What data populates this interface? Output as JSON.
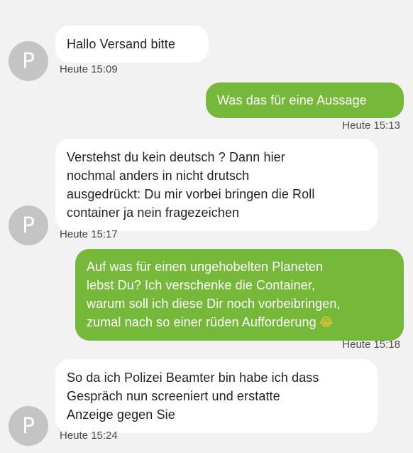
{
  "avatar_letter": "P",
  "messages": [
    {
      "direction": "in",
      "lines": [
        "Hallo Versand bitte"
      ],
      "time": "Heute 15:09"
    },
    {
      "direction": "out",
      "lines": [
        "Was das für eine Aussage"
      ],
      "time": "Heute 15:13"
    },
    {
      "direction": "in",
      "lines": [
        "Verstehst du kein deutsch ? Dann hier",
        "nochmal anders in nicht drutsch",
        "ausgedrückt: Du mir vorbei bringen die Roll",
        "container ja nein fragezeichen"
      ],
      "time": "Heute 15:17"
    },
    {
      "direction": "out",
      "lines": [
        "Auf was für einen ungehobelten Planeten",
        "lebst Du? Ich verschenke die Container,",
        "warum soll ich diese Dir noch vorbeibringen,",
        "zumal nach so einer rüden Aufforderung"
      ],
      "emoji": "😂",
      "time": "Heute 15:18"
    },
    {
      "direction": "in",
      "lines": [
        "So da ich Polizei Beamter bin habe ich dass",
        "Gespräch nun screeniert und erstatte",
        "Anzeige gegen Sie"
      ],
      "time": "Heute 15:24"
    }
  ],
  "colors": {
    "background": "#f2f2f2",
    "incoming_bubble": "#ffffff",
    "outgoing_bubble": "#75b83a",
    "avatar": "#c4c4c4"
  }
}
